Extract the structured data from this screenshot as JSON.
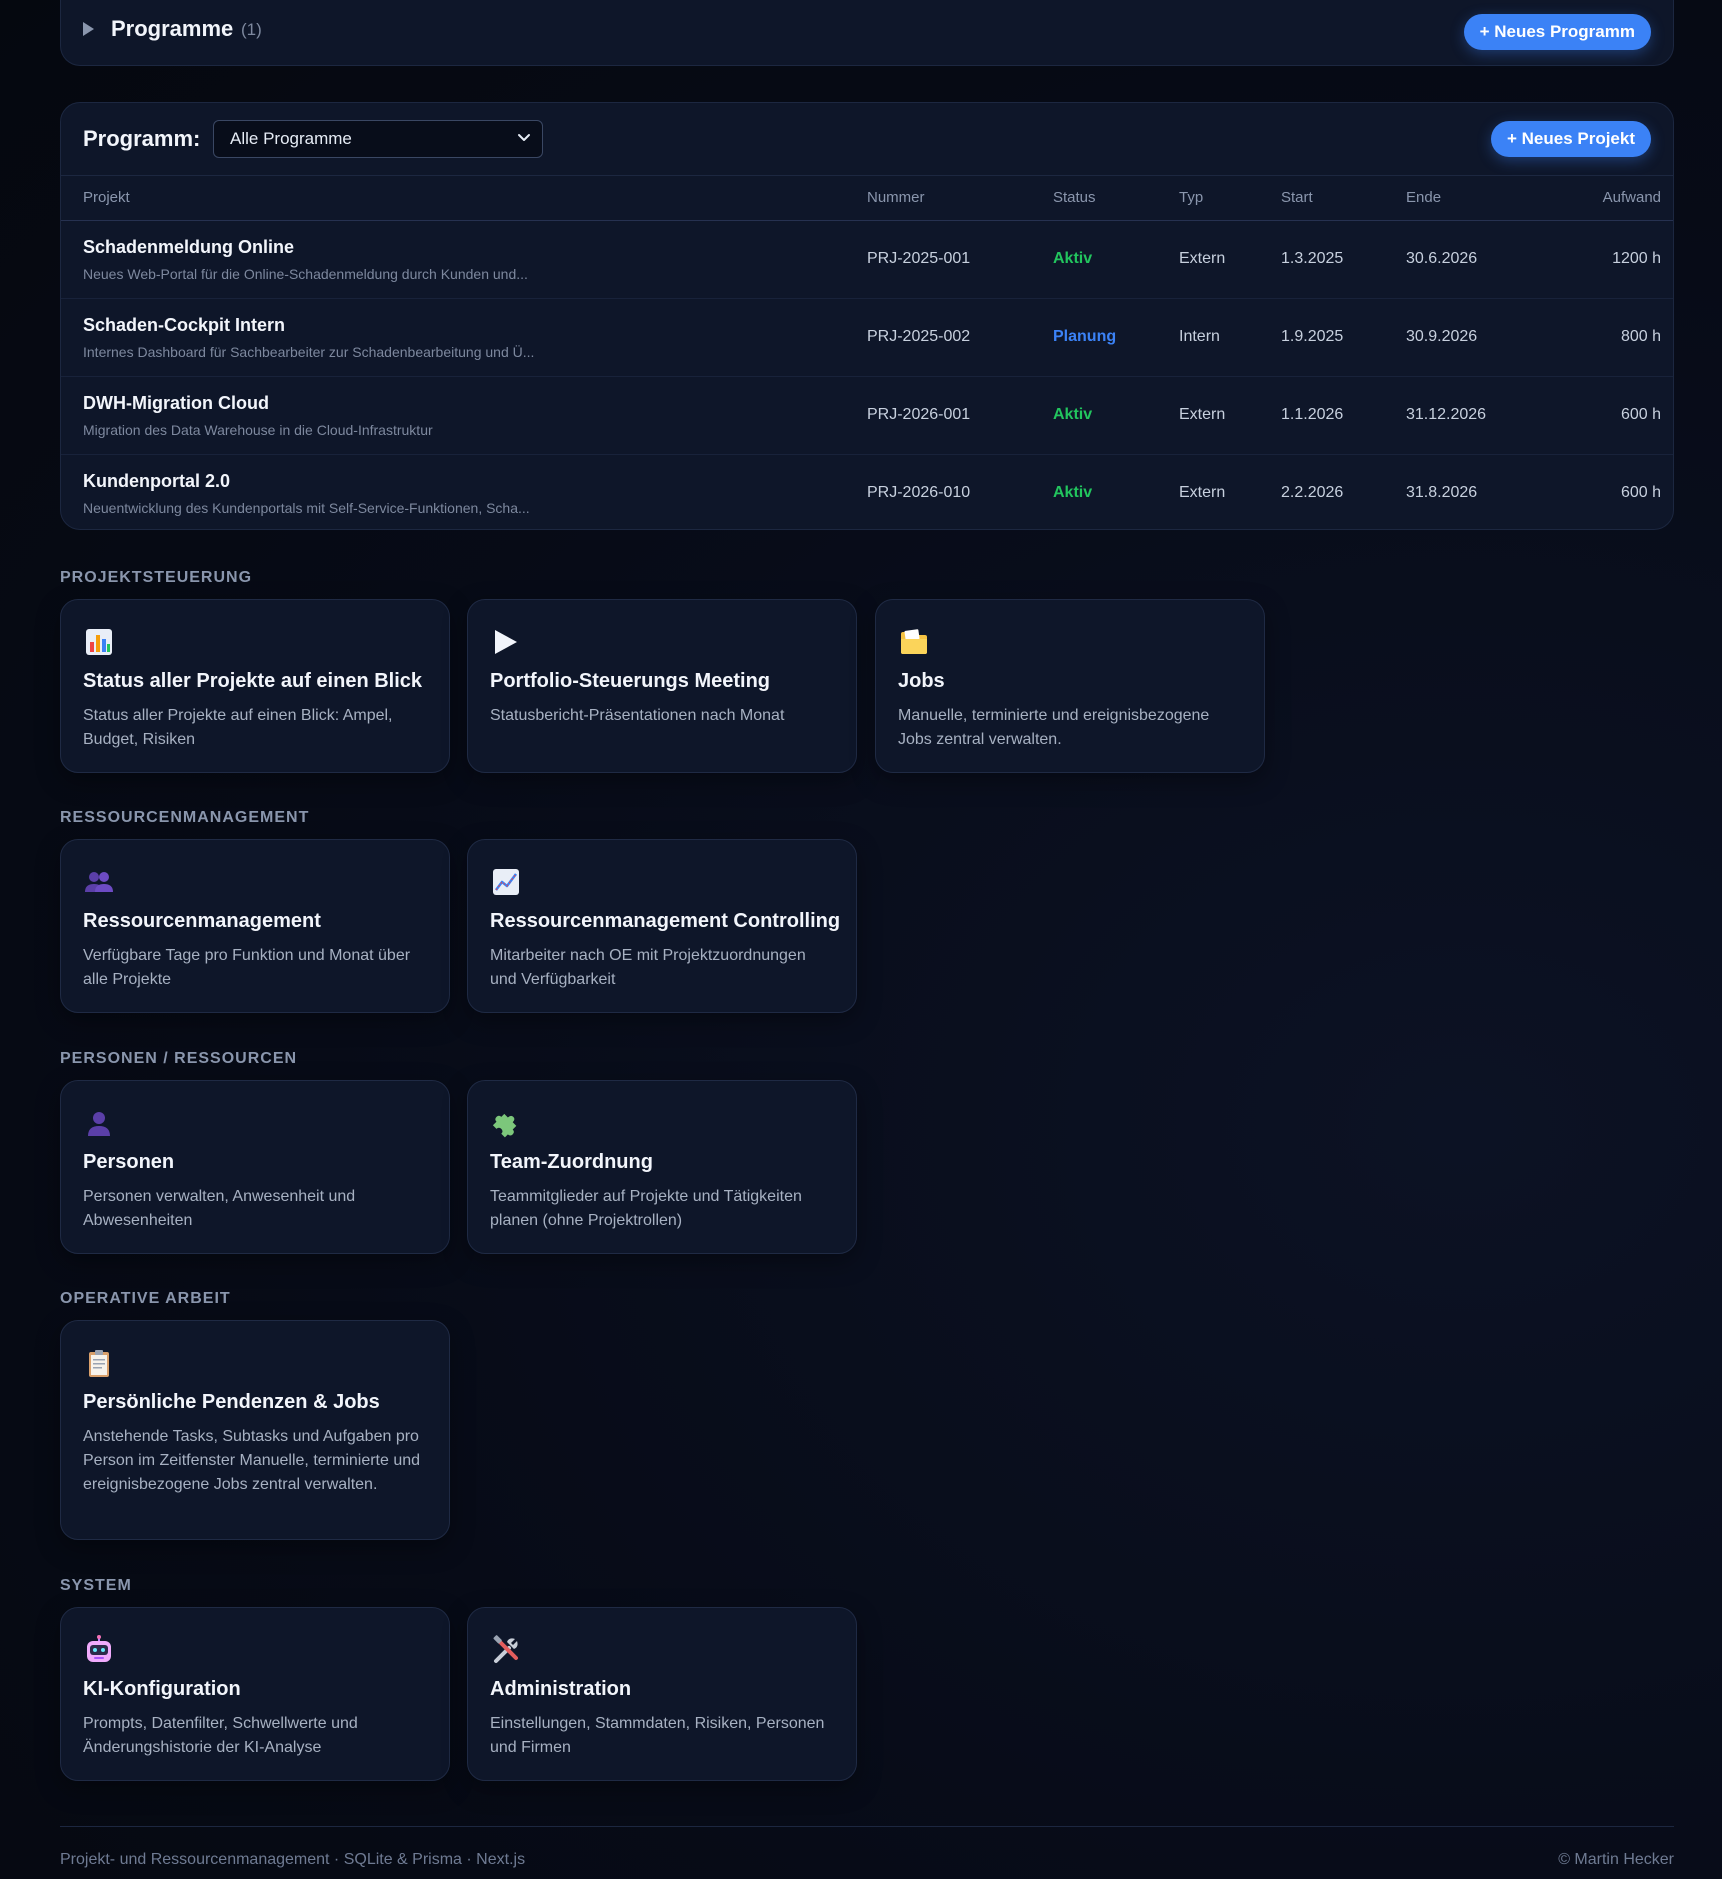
{
  "programs": {
    "title": "Programme",
    "count": "(1)",
    "new_button": "+ Neues Programm"
  },
  "projects": {
    "filter_label": "Programm:",
    "filter_value": "Alle Programme",
    "new_button": "+ Neues Projekt",
    "columns": [
      "Projekt",
      "Nummer",
      "Status",
      "Typ",
      "Start",
      "Ende",
      "Aufwand"
    ],
    "rows": [
      {
        "name": "Schadenmeldung Online",
        "desc": "Neues Web-Portal für die Online-Schadenmeldung durch Kunden und...",
        "number": "PRJ-2025-001",
        "status": "Aktiv",
        "type": "Extern",
        "start": "1.3.2025",
        "end": "30.6.2026",
        "effort": "1200 h"
      },
      {
        "name": "Schaden-Cockpit Intern",
        "desc": "Internes Dashboard für Sachbearbeiter zur Schadenbearbeitung und Ü...",
        "number": "PRJ-2025-002",
        "status": "Planung",
        "type": "Intern",
        "start": "1.9.2025",
        "end": "30.9.2026",
        "effort": "800 h"
      },
      {
        "name": "DWH-Migration Cloud",
        "desc": "Migration des Data Warehouse in die Cloud-Infrastruktur",
        "number": "PRJ-2026-001",
        "status": "Aktiv",
        "type": "Extern",
        "start": "1.1.2026",
        "end": "31.12.2026",
        "effort": "600 h"
      },
      {
        "name": "Kundenportal 2.0",
        "desc": "Neuentwicklung des Kundenportals mit Self-Service-Funktionen, Scha...",
        "number": "PRJ-2026-010",
        "status": "Aktiv",
        "type": "Extern",
        "start": "2.2.2026",
        "end": "31.8.2026",
        "effort": "600 h"
      }
    ]
  },
  "status_colors": {
    "Aktiv": "#22c55e",
    "Planung": "#3b82f6"
  },
  "sections": [
    {
      "title": "PROJEKTSTEUERUNG",
      "cards": [
        {
          "icon": "bar-chart-icon",
          "title": "Status aller Projekte auf einen Blick",
          "desc": "Status aller Projekte auf einen Blick: Ampel, Budget, Risiken"
        },
        {
          "icon": "play-icon",
          "title": "Portfolio-Steuerungs Meeting",
          "desc": "Statusbericht-Präsentationen nach Monat"
        },
        {
          "icon": "folder-icon",
          "title": "Jobs",
          "desc": "Manuelle, terminierte und ereignisbezogene Jobs zentral verwalten."
        }
      ]
    },
    {
      "title": "RESSOURCENMANAGEMENT",
      "cards": [
        {
          "icon": "people-icon",
          "title": "Ressourcenmanagement",
          "desc": "Verfügbare Tage pro Funktion und Monat über alle Projekte"
        },
        {
          "icon": "line-chart-icon",
          "title": "Ressourcenmanagement Controlling",
          "desc": "Mitarbeiter nach OE mit Projektzuordnungen und Verfügbarkeit"
        }
      ]
    },
    {
      "title": "PERSONEN / RESSOURCEN",
      "cards": [
        {
          "icon": "person-icon",
          "title": "Personen",
          "desc": "Personen verwalten, Anwesenheit und Abwesenheiten"
        },
        {
          "icon": "puzzle-icon",
          "title": "Team-Zuordnung",
          "desc": "Teammitglieder auf Projekte und Tätigkeiten planen (ohne Projektrollen)"
        }
      ]
    },
    {
      "title": "OPERATIVE ARBEIT",
      "cards": [
        {
          "icon": "clipboard-icon",
          "title": "Persönliche Pendenzen & Jobs",
          "desc": "Anstehende Tasks, Subtasks und Aufgaben pro Person im Zeitfenster Manuelle, terminierte und ereignisbezogene Jobs zentral verwalten."
        }
      ]
    },
    {
      "title": "SYSTEM",
      "cards": [
        {
          "icon": "robot-icon",
          "title": "KI-Konfiguration",
          "desc": "Prompts, Datenfilter, Schwellwerte und Änderungshistorie der KI-Analyse"
        },
        {
          "icon": "tools-icon",
          "title": "Administration",
          "desc": "Einstellungen, Stammdaten, Risiken, Personen und Firmen"
        }
      ]
    }
  ],
  "footer": {
    "left": "Projekt- und Ressourcenmanagement · SQLite & Prisma · Next.js",
    "right": "© Martin Hecker"
  }
}
